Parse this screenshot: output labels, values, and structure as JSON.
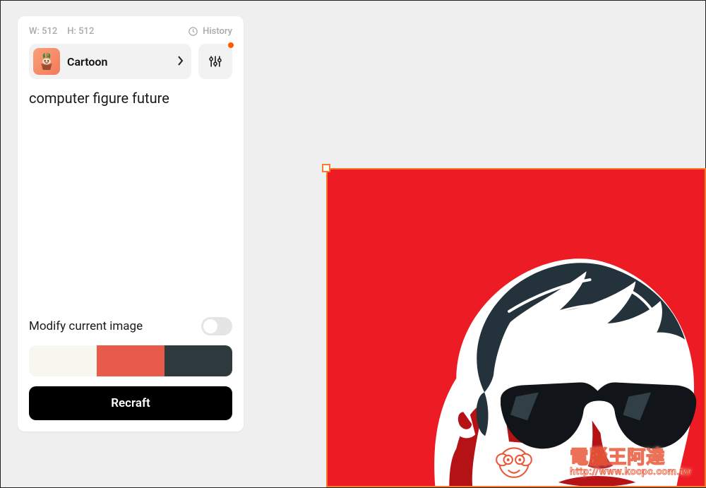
{
  "panel": {
    "width_label": "W: 512",
    "height_label": "H: 512",
    "history_label": "History",
    "style": {
      "label": "Cartoon",
      "thumb_icon": "plant-pot-icon"
    },
    "settings_has_badge": true,
    "prompt": "computer figure future",
    "modify_label": "Modify current image",
    "modify_enabled": false,
    "palette": [
      "#f8f7ef",
      "#e85a4a",
      "#2f3a3f"
    ],
    "action_label": "Recraft"
  },
  "canvas": {
    "selected": true,
    "bg_color": "#ed1c24"
  },
  "watermark": {
    "line1": "電腦王阿達",
    "line2": "http://www.kocpc.com.tw"
  }
}
